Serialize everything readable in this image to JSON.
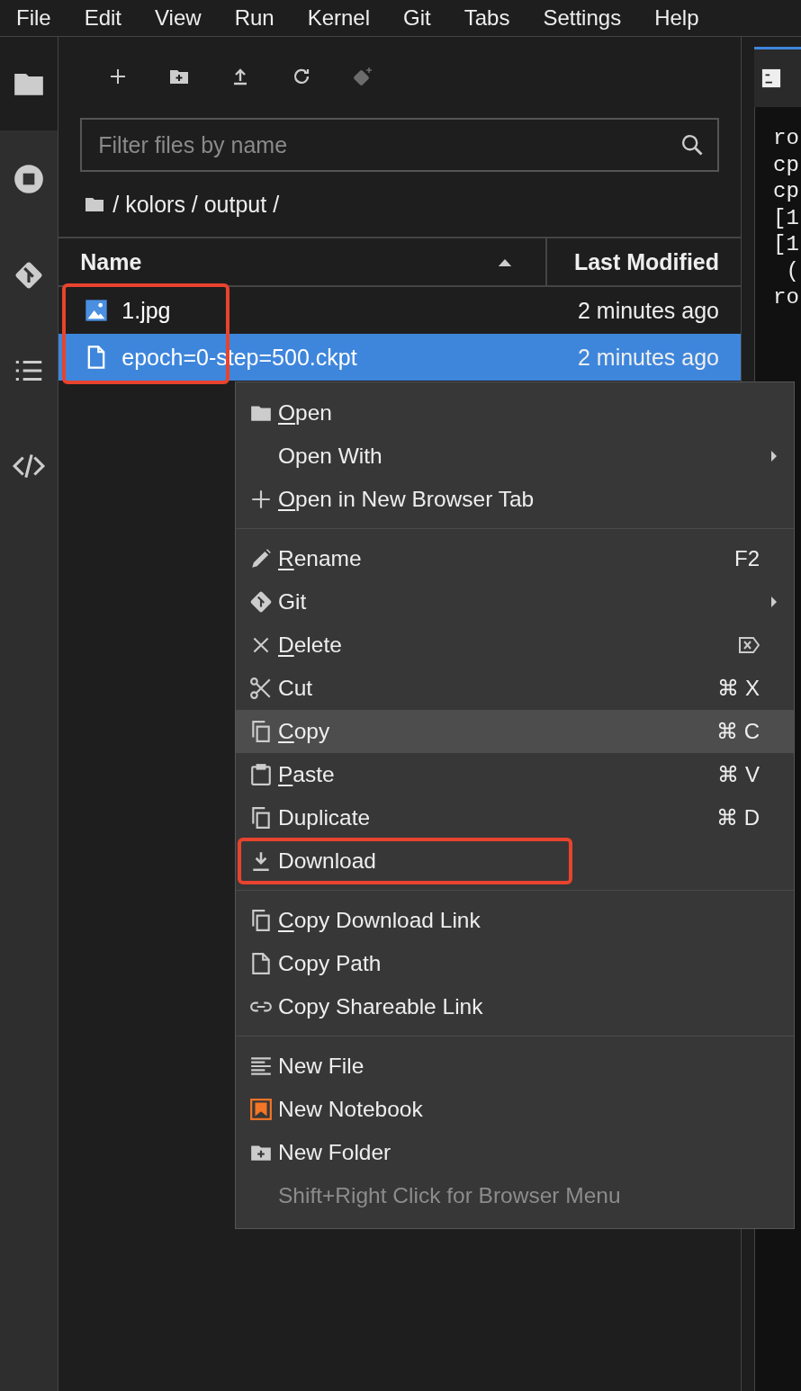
{
  "menubar": [
    "File",
    "Edit",
    "View",
    "Run",
    "Kernel",
    "Git",
    "Tabs",
    "Settings",
    "Help"
  ],
  "sidebar": {
    "items": [
      {
        "selected": true
      },
      {
        "selected": false
      },
      {
        "selected": false
      },
      {
        "selected": false
      },
      {
        "selected": false
      }
    ]
  },
  "toolbar": [
    {
      "disabled": false
    },
    {
      "disabled": false
    },
    {
      "disabled": false
    },
    {
      "disabled": false
    },
    {
      "disabled": true
    }
  ],
  "filter": {
    "placeholder": "Filter files by name"
  },
  "breadcrumb": "/ kolors / output /",
  "table": {
    "columns": [
      "Name",
      "Last Modified"
    ]
  },
  "files": [
    {
      "kind": "image",
      "name": "1.jpg",
      "modified": "2 minutes ago",
      "selected": false,
      "marked": true
    },
    {
      "kind": "file",
      "name": "epoch=0-step=500.ckpt",
      "modified": "2 minutes ago",
      "selected": true,
      "marked": true
    }
  ],
  "terminal": {
    "lines": [
      "ro",
      "cp",
      "cp",
      "[1",
      "[1",
      " (",
      "ro"
    ]
  },
  "context_menu": {
    "groups": [
      [
        {
          "label": "Open",
          "underline_first": true,
          "submenu": false,
          "highlighted": false,
          "marked": false
        },
        {
          "label": "Open With",
          "underline_first": false,
          "submenu": true,
          "highlighted": false,
          "marked": false
        },
        {
          "label": "Open in New Browser Tab",
          "underline_first": true,
          "submenu": false,
          "highlighted": false,
          "marked": false
        }
      ],
      [
        {
          "label": "Rename",
          "underline_first": true,
          "shortcut": "F2",
          "submenu": false,
          "highlighted": false,
          "marked": false
        },
        {
          "label": "Git",
          "underline_first": false,
          "submenu": true,
          "highlighted": false,
          "marked": false
        },
        {
          "label": "Delete",
          "underline_first": true,
          "submenu": false,
          "highlighted": false,
          "marked": false
        },
        {
          "label": "Cut",
          "underline_first": false,
          "shortcut": "⌘ X",
          "submenu": false,
          "highlighted": false,
          "marked": false
        },
        {
          "label": "Copy",
          "underline_first": true,
          "shortcut": "⌘ C",
          "submenu": false,
          "highlighted": true,
          "marked": false
        },
        {
          "label": "Paste",
          "underline_first": true,
          "shortcut": "⌘ V",
          "submenu": false,
          "highlighted": false,
          "marked": false
        },
        {
          "label": "Duplicate",
          "underline_first": false,
          "shortcut": "⌘ D",
          "submenu": false,
          "highlighted": false,
          "marked": false
        },
        {
          "label": "Download",
          "underline_first": false,
          "submenu": false,
          "highlighted": false,
          "marked": true
        }
      ],
      [
        {
          "label": "Copy Download Link",
          "underline_first": true,
          "submenu": false,
          "highlighted": false,
          "marked": false
        },
        {
          "label": "Copy Path",
          "underline_first": false,
          "submenu": false,
          "highlighted": false,
          "marked": false
        },
        {
          "label": "Copy Shareable Link",
          "underline_first": false,
          "submenu": false,
          "highlighted": false,
          "marked": false
        }
      ],
      [
        {
          "label": "New File",
          "underline_first": false,
          "submenu": false,
          "highlighted": false,
          "marked": false
        },
        {
          "label": "New Notebook",
          "underline_first": false,
          "submenu": false,
          "highlighted": false,
          "marked": false
        },
        {
          "label": "New Folder",
          "underline_first": false,
          "submenu": false,
          "highlighted": false,
          "marked": false
        },
        {
          "label": "Shift+Right Click for Browser Menu",
          "underline_first": false,
          "disabled": true,
          "submenu": false,
          "highlighted": false,
          "marked": false
        }
      ]
    ]
  }
}
